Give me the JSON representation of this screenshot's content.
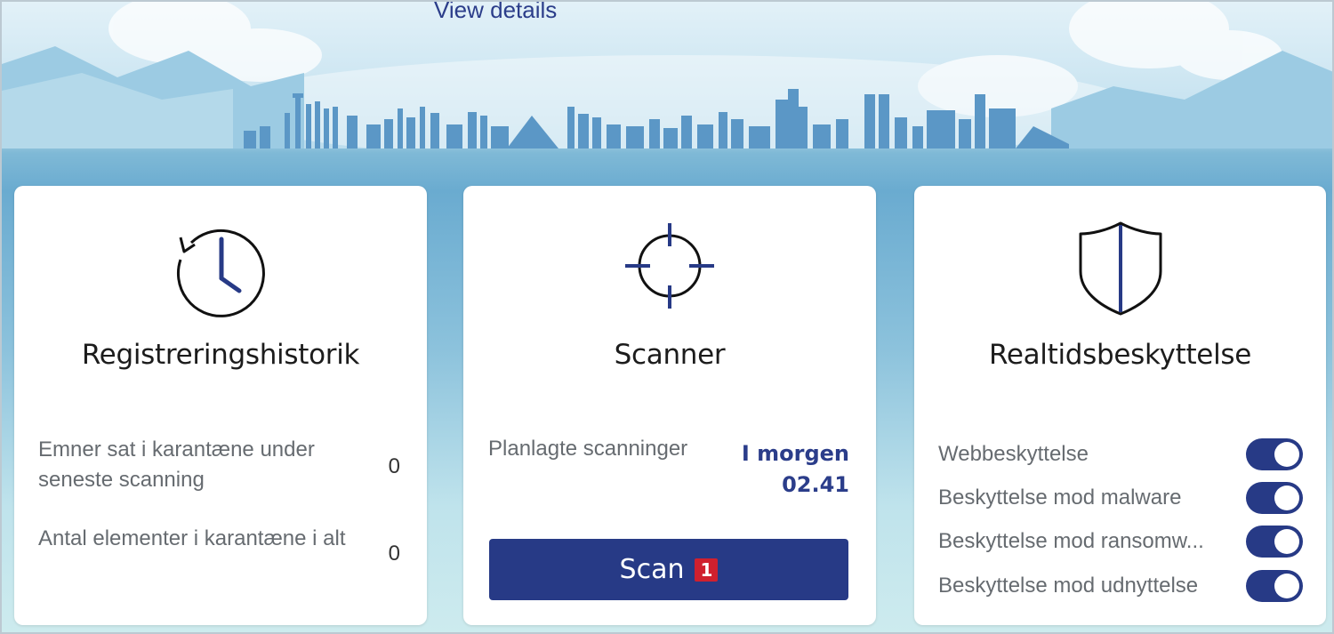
{
  "header": {
    "link_label": "View details"
  },
  "cards": {
    "history": {
      "title": "Registreringshistorik",
      "icon": "clock-history-icon",
      "stats": [
        {
          "label": "Emner sat i karantæne under seneste scanning",
          "value": "0"
        },
        {
          "label": "Antal elementer i karantæne i alt",
          "value": "0"
        }
      ]
    },
    "scanner": {
      "title": "Scanner",
      "icon": "crosshair-icon",
      "scheduled_label": "Planlagte scanninger",
      "scheduled_day": "I morgen",
      "scheduled_time": "02.41",
      "scan_button_label": "Scan",
      "scan_badge": "1"
    },
    "protection": {
      "title": "Realtidsbeskyttelse",
      "icon": "shield-icon",
      "toggles": [
        {
          "label": "Webbeskyttelse",
          "on": true
        },
        {
          "label": "Beskyttelse mod malware",
          "on": true
        },
        {
          "label": "Beskyttelse mod ransomw...",
          "on": true
        },
        {
          "label": "Beskyttelse mod udnyttelse",
          "on": true
        }
      ]
    }
  },
  "colors": {
    "accent": "#273a86",
    "badge": "#d0202e",
    "sky_light": "#d7ecf5",
    "skyline": "#5b97c6"
  }
}
